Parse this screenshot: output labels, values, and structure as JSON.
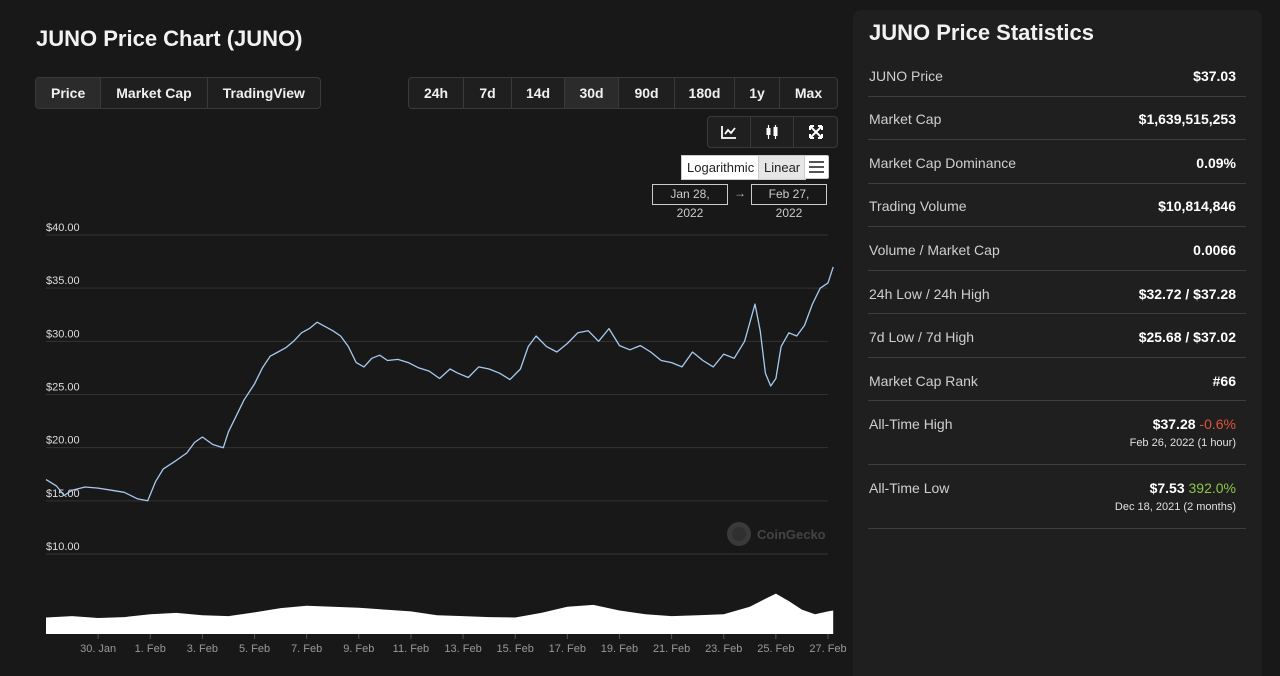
{
  "header": {
    "title": "JUNO Price Chart (JUNO)"
  },
  "type_tabs": [
    {
      "label": "Price",
      "active": true
    },
    {
      "label": "Market Cap",
      "active": false
    },
    {
      "label": "TradingView",
      "active": false
    }
  ],
  "range_tabs": [
    {
      "label": "24h",
      "active": false
    },
    {
      "label": "7d",
      "active": false
    },
    {
      "label": "14d",
      "active": false
    },
    {
      "label": "30d",
      "active": true
    },
    {
      "label": "90d",
      "active": false
    },
    {
      "label": "180d",
      "active": false
    },
    {
      "label": "1y",
      "active": false
    },
    {
      "label": "Max",
      "active": false
    }
  ],
  "tools": {
    "line_icon": "line-chart-icon",
    "candle_icon": "candlestick-icon",
    "fullscreen_icon": "fullscreen-icon"
  },
  "scale": {
    "log_label": "Logarithmic",
    "linear_label": "Linear",
    "selected": "Linear"
  },
  "date_range": {
    "from": "Jan 28, 2022",
    "arrow": "→",
    "to": "Feb 27, 2022"
  },
  "watermark": "CoinGecko",
  "colors": {
    "line": "#a8c9ef",
    "volume": "#ffffff",
    "negative": "#e15241",
    "positive": "#8dc647"
  },
  "chart_data": {
    "type": "line",
    "y_ticks": [
      "$40.00",
      "$35.00",
      "$30.00",
      "$25.00",
      "$20.00",
      "$15.00",
      "$10.00"
    ],
    "y_tick_values": [
      40,
      35,
      30,
      25,
      20,
      15,
      10
    ],
    "ylim": [
      10,
      40
    ],
    "xlim": [
      28,
      58
    ],
    "x_ticks": [
      "30. Jan",
      "1. Feb",
      "3. Feb",
      "5. Feb",
      "7. Feb",
      "9. Feb",
      "11. Feb",
      "13. Feb",
      "15. Feb",
      "17. Feb",
      "19. Feb",
      "21. Feb",
      "23. Feb",
      "25. Feb",
      "27. Feb"
    ],
    "x_tick_values": [
      30,
      32,
      34,
      36,
      38,
      40,
      42,
      44,
      46,
      48,
      50,
      52,
      54,
      56,
      58
    ],
    "x_unit": "days since Jan 1, 2022",
    "price": {
      "x": [
        28.0,
        28.4,
        28.7,
        29.0,
        29.5,
        30.0,
        30.5,
        31.0,
        31.5,
        31.9,
        32.2,
        32.5,
        33.0,
        33.4,
        33.7,
        34.0,
        34.4,
        34.8,
        35.0,
        35.3,
        35.6,
        36.0,
        36.3,
        36.6,
        36.9,
        37.2,
        37.5,
        37.8,
        38.1,
        38.4,
        38.7,
        39.0,
        39.3,
        39.6,
        39.9,
        40.2,
        40.5,
        40.8,
        41.1,
        41.5,
        41.9,
        42.3,
        42.7,
        43.1,
        43.5,
        43.8,
        44.2,
        44.6,
        45.0,
        45.4,
        45.8,
        46.2,
        46.5,
        46.8,
        47.2,
        47.6,
        48.0,
        48.4,
        48.8,
        49.2,
        49.6,
        50.0,
        50.4,
        50.8,
        51.2,
        51.6,
        52.0,
        52.4,
        52.8,
        53.2,
        53.6,
        54.0,
        54.4,
        54.8,
        55.2,
        55.4,
        55.6,
        55.8,
        56.0,
        56.2,
        56.5,
        56.8,
        57.1,
        57.4,
        57.7,
        58.0,
        58.2
      ],
      "y": [
        17.0,
        16.4,
        15.5,
        16.0,
        16.3,
        16.2,
        16.0,
        15.8,
        15.2,
        15.0,
        16.8,
        18.0,
        18.8,
        19.5,
        20.5,
        21.0,
        20.3,
        20.0,
        21.5,
        23.0,
        24.5,
        26.0,
        27.5,
        28.6,
        29.0,
        29.4,
        30.0,
        30.8,
        31.2,
        31.8,
        31.4,
        31.0,
        30.5,
        29.5,
        28.0,
        27.6,
        28.4,
        28.7,
        28.2,
        28.3,
        28.0,
        27.5,
        27.2,
        26.5,
        27.4,
        27.0,
        26.6,
        27.6,
        27.4,
        27.0,
        26.4,
        27.4,
        29.5,
        30.5,
        29.5,
        29.0,
        29.8,
        30.8,
        31.0,
        30.0,
        31.2,
        29.6,
        29.2,
        29.6,
        29.0,
        28.2,
        28.0,
        27.6,
        29.0,
        28.2,
        27.6,
        28.8,
        28.4,
        30.0,
        33.5,
        31.0,
        27.0,
        25.8,
        26.5,
        29.5,
        30.8,
        30.5,
        31.5,
        33.5,
        35.0,
        35.5,
        37.0
      ]
    },
    "volume": {
      "x": [
        28,
        29,
        30,
        31,
        32,
        33,
        34,
        35,
        36,
        37,
        38,
        39,
        40,
        41,
        42,
        43,
        44,
        45,
        46,
        47,
        48,
        49,
        50,
        51,
        52,
        53,
        54,
        55,
        55.6,
        56,
        56.5,
        57,
        57.5,
        58,
        58.2
      ],
      "y": [
        0.35,
        0.38,
        0.34,
        0.36,
        0.42,
        0.45,
        0.4,
        0.38,
        0.46,
        0.55,
        0.6,
        0.58,
        0.56,
        0.52,
        0.48,
        0.4,
        0.38,
        0.36,
        0.35,
        0.45,
        0.58,
        0.62,
        0.5,
        0.42,
        0.38,
        0.4,
        0.42,
        0.58,
        0.75,
        0.86,
        0.7,
        0.52,
        0.42,
        0.48,
        0.5
      ]
    }
  },
  "stats": {
    "title": "JUNO Price Statistics",
    "rows": [
      {
        "label": "JUNO Price",
        "value": "$37.03"
      },
      {
        "label": "Market Cap",
        "value": "$1,639,515,253"
      },
      {
        "label": "Market Cap Dominance",
        "value": "0.09%"
      },
      {
        "label": "Trading Volume",
        "value": "$10,814,846"
      },
      {
        "label": "Volume / Market Cap",
        "value": "0.0066"
      },
      {
        "label": "24h Low / 24h High",
        "value": "$32.72 / $37.28"
      },
      {
        "label": "7d Low / 7d High",
        "value": "$25.68 / $37.02"
      },
      {
        "label": "Market Cap Rank",
        "value": "#66"
      }
    ],
    "ath": {
      "label": "All-Time High",
      "value": "$37.28",
      "change": "-0.6%",
      "date": "Feb 26, 2022 (1 hour)"
    },
    "atl": {
      "label": "All-Time Low",
      "value": "$7.53",
      "change": "392.0%",
      "date": "Dec 18, 2021 (2 months)"
    }
  }
}
